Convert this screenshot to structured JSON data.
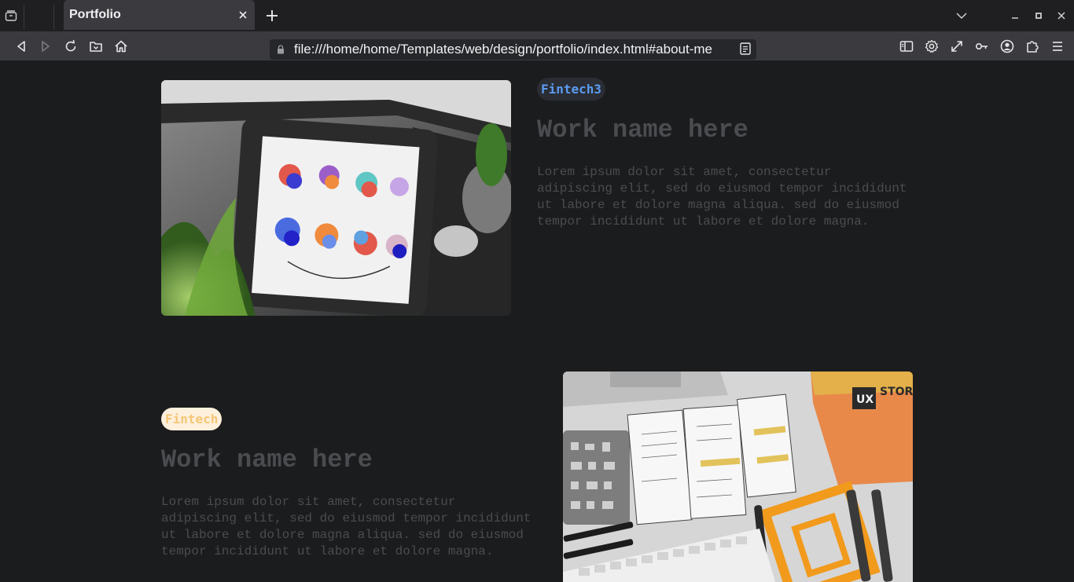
{
  "browser": {
    "tab_title": "Portfolio",
    "url": "file:///home/home/Templates/web/design/portfolio/index.html#about-me",
    "icons": {
      "collections": "collections-icon",
      "new_tab": "plus-icon",
      "tab_close": "close-icon",
      "list_tabs": "chevron-down-icon",
      "minimize": "minimize-icon",
      "maximize": "maximize-icon",
      "close_window": "close-window-icon",
      "back": "back-icon",
      "forward": "forward-icon",
      "reload": "reload-icon",
      "save": "save-to-pocket-icon",
      "home": "home-icon",
      "lock": "lock-icon",
      "reader": "reader-view-icon",
      "sidebar": "sidebar-icon",
      "settings": "gear-icon",
      "fullscreen": "expand-icon",
      "passwords": "key-icon",
      "account": "account-icon",
      "extensions": "puzzle-icon",
      "menu": "hamburger-menu-icon"
    }
  },
  "works": [
    {
      "tag": "Fintech3",
      "title": "Work name here",
      "description": "Lorem ipsum dolor sit amet, consectetur adipiscing elit, sed do eiusmod tempor incididunt ut labore et dolore magna aliqua. sed do eiusmod tempor incididunt ut labore et dolore magna.",
      "tag_color": "#5b9bf0",
      "tag_bg": "#2a2d33",
      "image": "tablet-sketch-photo"
    },
    {
      "tag": "Fintech",
      "title": "Work name here",
      "description": "Lorem ipsum dolor sit amet, consectetur adipiscing elit, sed do eiusmod tempor incididunt ut labore et dolore magna aliqua. sed do eiusmod tempor incididunt ut labore et dolore magna.",
      "tag_color": "#f6c676",
      "tag_bg": "#fdf0dc",
      "image": "ux-store-wireframe-photo"
    }
  ]
}
